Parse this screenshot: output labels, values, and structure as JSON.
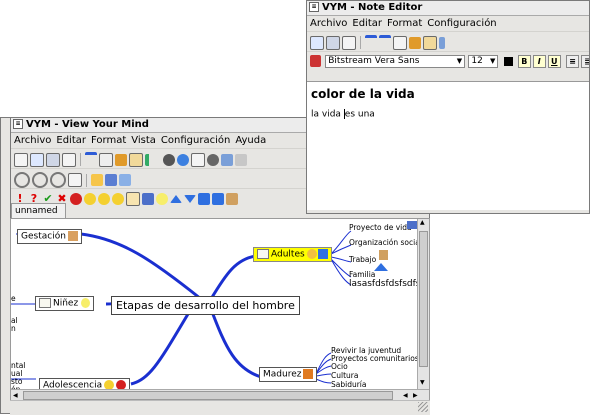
{
  "main_window": {
    "title": "VYM - View Your Mind",
    "menu": [
      "Archivo",
      "Editar",
      "Format",
      "Vista",
      "Configuración",
      "Ayuda"
    ],
    "tab_label": "unnamed"
  },
  "note_editor": {
    "title": "VYM - Note Editor",
    "menu": [
      "Archivo",
      "Editar",
      "Format",
      "Configuración"
    ],
    "font_name": "Bitstream Vera Sans",
    "font_size": "12",
    "format_buttons": [
      "B",
      "I",
      "U"
    ],
    "heading": "color de la vida",
    "body_before_cursor": "la vida ",
    "body_after_cursor": "es una"
  },
  "mindmap": {
    "center": "Etapas de desarrollo del hombre",
    "nodes": {
      "gestacion": "Gestación",
      "ninez": "Niñez",
      "adultes": "Adultes",
      "madurez": "Madurez",
      "adolescencia": "Adolescencia"
    },
    "adultes_children": [
      "Proyecto de vida",
      "Organización social",
      "Trabajo",
      "Familia",
      "lasasfdsfdsfsdfsdf"
    ],
    "madurez_children": [
      "Revivir la juventud",
      "Proyectos comunitarios",
      "Ocio",
      "Cultura",
      "Sabiduría"
    ],
    "left_clipped_ninez": [
      "e",
      "al",
      "n"
    ],
    "left_clipped_adolescencia": [
      "ntal",
      "ual",
      "sto",
      "ón"
    ]
  },
  "colors": {
    "branch": "#1a2fd0",
    "highlight": "#ffff00",
    "window_bg": "#e7e6e3"
  }
}
